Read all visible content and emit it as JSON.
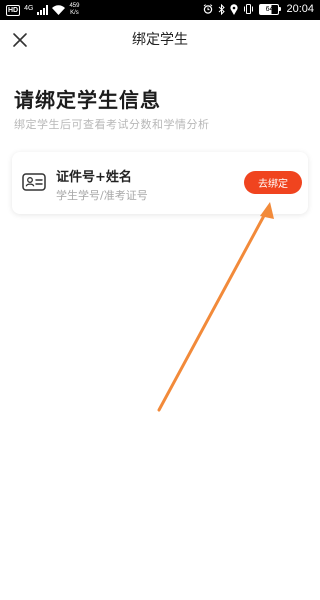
{
  "status_bar": {
    "hd": "HD",
    "network": "4G",
    "speed_value": "459",
    "speed_unit": "K/s",
    "battery": "64",
    "time": "20:04"
  },
  "nav": {
    "title": "绑定学生"
  },
  "main": {
    "heading": "请绑定学生信息",
    "subheading": "绑定学生后可查看考试分数和学情分析"
  },
  "card": {
    "title": "证件号+姓名",
    "hint": "学生学号/准考证号",
    "button_label": "去绑定"
  },
  "colors": {
    "accent": "#f0441f",
    "arrow": "#f28a3a"
  }
}
